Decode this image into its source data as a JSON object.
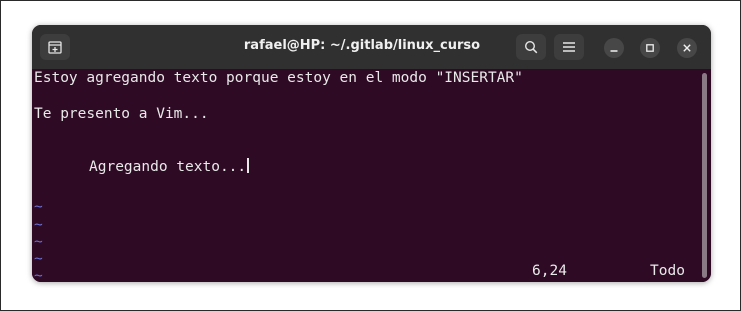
{
  "window": {
    "title": "rafael@HP: ~/.gitlab/linux_curso",
    "colors": {
      "terminal_bg": "#2e0a24",
      "titlebar_bg": "#303030",
      "text": "#e9e9e9",
      "tilde": "#6a6fd6"
    }
  },
  "toolbar": {
    "new_tab_icon": "new-tab-icon",
    "search_icon": "search-icon",
    "menu_icon": "hamburger-menu-icon",
    "minimize_icon": "minimize-icon",
    "maximize_icon": "maximize-icon",
    "close_icon": "close-icon"
  },
  "editor": {
    "lines": [
      "Estoy agregando texto porque estoy en el modo \"INSERTAR\"",
      "Te presento a Vim...",
      "Agregando texto.."
    ],
    "cursor_char": ".",
    "empty_line_marker": "~",
    "ruler_position": "6,24",
    "ruler_scroll": "Todo"
  }
}
